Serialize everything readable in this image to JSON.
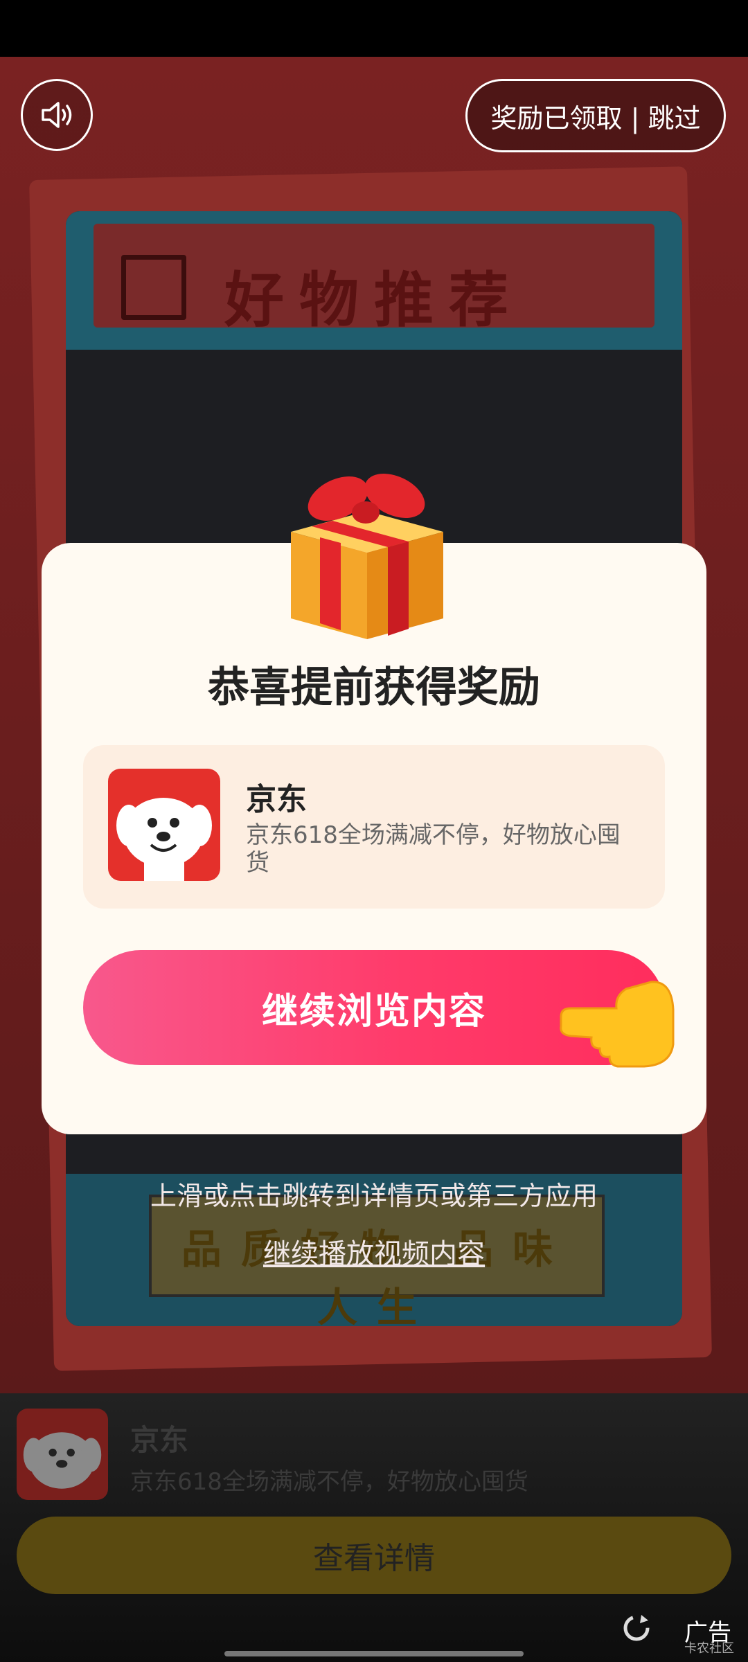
{
  "top": {
    "skip_label": "奖励已领取 | 跳过"
  },
  "background": {
    "poster_title": "好物推荐",
    "poster_footer": "品质好物 品味人生"
  },
  "dialog": {
    "title": "恭喜提前获得奖励",
    "app_name": "京东",
    "app_desc": "京东618全场满减不停，好物放心囤货",
    "continue_button": "继续浏览内容"
  },
  "hints": {
    "swipe": "上滑或点击跳转到详情页或第三方应用",
    "continue_video": "继续播放视频内容"
  },
  "bottom": {
    "app_name": "京东",
    "app_desc": "京东618全场满减不停，好物放心囤货",
    "details_button": "查看详情",
    "ad_label": "广告",
    "watermark": "卡农社区"
  },
  "colors": {
    "accent": "#ff3b6a",
    "jd_red": "#e4302b"
  }
}
